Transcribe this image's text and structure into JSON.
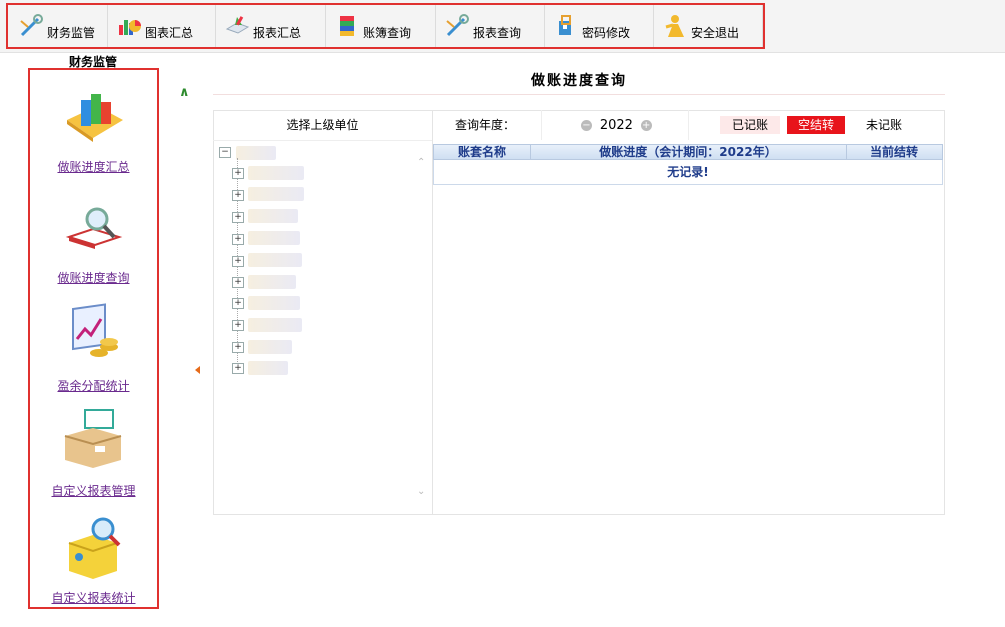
{
  "toolbar": {
    "items": [
      {
        "label": "财务监管",
        "icon": "financial-supervision-icon"
      },
      {
        "label": "图表汇总",
        "icon": "chart-summary-icon"
      },
      {
        "label": "报表汇总",
        "icon": "report-summary-icon"
      },
      {
        "label": "账簿查询",
        "icon": "ledger-query-icon"
      },
      {
        "label": "报表查询",
        "icon": "report-query-icon"
      },
      {
        "label": "密码修改",
        "icon": "password-change-icon"
      },
      {
        "label": "安全退出",
        "icon": "logout-icon"
      }
    ],
    "highlight_color": "#e0312f"
  },
  "sidebar": {
    "title": "财务监管",
    "items": [
      {
        "label": "做账进度汇总",
        "icon": "bookkeeping-progress-summary-icon"
      },
      {
        "label": "做账进度查询",
        "icon": "bookkeeping-progress-query-icon"
      },
      {
        "label": "盈余分配统计",
        "icon": "surplus-distribution-icon"
      },
      {
        "label": "自定义报表管理",
        "icon": "custom-report-management-icon"
      },
      {
        "label": "自定义报表统计",
        "icon": "custom-report-statistics-icon"
      }
    ],
    "link_color": "#6a2a8e"
  },
  "main": {
    "title": "做账进度查询",
    "tree_header": "选择上级单位",
    "tree_node_count": 11,
    "filter": {
      "year_label": "查询年度：",
      "year_value": "2022"
    },
    "legend": [
      {
        "label": "已记账",
        "bg": "#fde9e9",
        "color": "#000"
      },
      {
        "label": "空结转",
        "bg": "#e8141b",
        "color": "#fff"
      },
      {
        "label": "未记账",
        "bg": "#ffffff",
        "color": "#000"
      }
    ],
    "table": {
      "columns": [
        "账套名称",
        "做账进度（会计期间：2022年）",
        "当前结转"
      ],
      "empty_text": "无记录!"
    }
  }
}
